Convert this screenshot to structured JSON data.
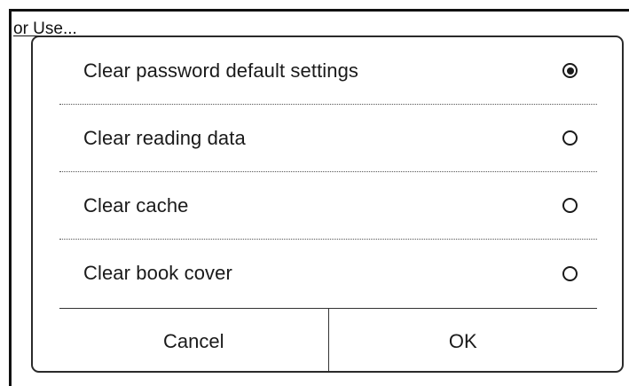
{
  "background": {
    "partial_text": "or Use..."
  },
  "dialog": {
    "options": [
      {
        "label": "Clear password default settings",
        "selected": true
      },
      {
        "label": "Clear reading data",
        "selected": false
      },
      {
        "label": "Clear cache",
        "selected": false
      },
      {
        "label": "Clear book cover",
        "selected": false
      }
    ],
    "buttons": {
      "cancel_label": "Cancel",
      "ok_label": "OK"
    }
  }
}
